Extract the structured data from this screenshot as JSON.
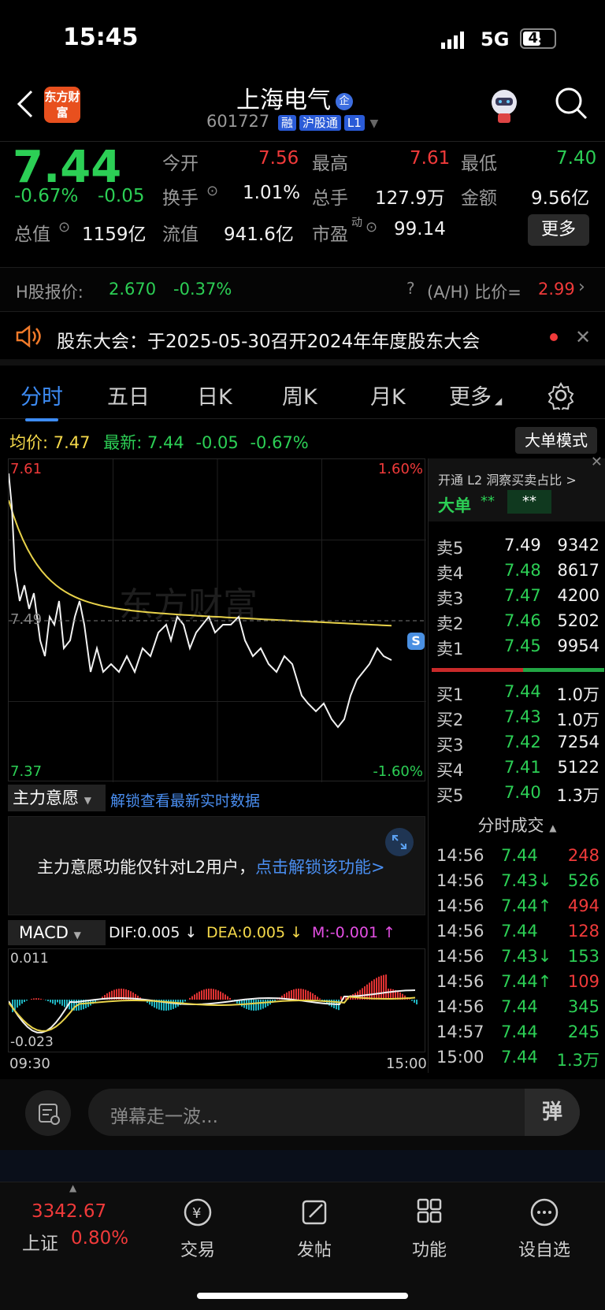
{
  "status_bar": {
    "time": "15:45",
    "network": "5G",
    "battery": "45"
  },
  "header": {
    "back_label": "<",
    "logo_text": "东方财富",
    "title": "上海电气",
    "title_badge": "企",
    "code": "601727",
    "tags": [
      "融",
      "沪股通",
      "L1"
    ],
    "colors": {
      "accent": "#3d8cf5",
      "up": "#f03a3a",
      "down": "#2ccf55"
    }
  },
  "quote": {
    "price": "7.44",
    "change_pct": "-0.67%",
    "change_amt": "-0.05",
    "open_label": "今开",
    "open": "7.56",
    "high_label": "最高",
    "high": "7.61",
    "low_label": "最低",
    "low": "7.40",
    "turnover_label": "换手",
    "turnover": "1.01%",
    "volume_label": "总手",
    "volume": "127.9万",
    "amount_label": "金额",
    "amount": "9.56亿",
    "mktcap_label": "总值",
    "mktcap": "1159亿",
    "float_label": "流值",
    "float": "941.6亿",
    "pe_label": "市盈",
    "pe_sup": "动",
    "pe": "99.14",
    "more_label": "更多"
  },
  "h_share": {
    "label": "H股报价:",
    "price": "2.670",
    "change": "-0.37%",
    "ratio_label": "(A/H) 比价=",
    "ratio": "2.99"
  },
  "notice": {
    "text": "股东大会：于2025-05-30召开2024年年度股东大会"
  },
  "tabs": [
    "分时",
    "五日",
    "日K",
    "周K",
    "月K",
    "更多"
  ],
  "intraday": {
    "avg_label": "均价:",
    "avg": "7.47",
    "latest_label": "最新:",
    "latest": "7.44",
    "latest_chg": "-0.05",
    "latest_pct": "-0.67%",
    "mode_button": "大单模式",
    "price_top": "7.61",
    "price_bottom": "7.37",
    "price_mid": "7.49",
    "pct_top": "1.60%",
    "pct_bottom": "-1.60%",
    "watermark": "东方财富",
    "marker": "S"
  },
  "main_force": {
    "dropdown": "主力意愿",
    "unlock_link": "解锁查看最新实时数据",
    "message": "主力意愿功能仅针对L2用户，",
    "message_link": "点击解锁该功能>"
  },
  "macd": {
    "dropdown": "MACD",
    "dif": "DIF:0.005 ↓",
    "dea": "DEA:0.005 ↓",
    "m": "M:-0.001 ↑",
    "y_top": "0.011",
    "y_bottom": "-0.023",
    "time_start": "09:30",
    "time_end": "15:00"
  },
  "order_book": {
    "l2_banner": "开通 L2 洞察买卖占比 >",
    "big_label": "大单",
    "big_val1": "**",
    "big_val2": "**",
    "asks": [
      {
        "label": "卖5",
        "price": "7.49",
        "vol": "9342"
      },
      {
        "label": "卖4",
        "price": "7.48",
        "vol": "8617"
      },
      {
        "label": "卖3",
        "price": "7.47",
        "vol": "4200"
      },
      {
        "label": "卖2",
        "price": "7.46",
        "vol": "5202"
      },
      {
        "label": "卖1",
        "price": "7.45",
        "vol": "9954"
      }
    ],
    "bids": [
      {
        "label": "买1",
        "price": "7.44",
        "vol": "1.0万"
      },
      {
        "label": "买2",
        "price": "7.43",
        "vol": "1.0万"
      },
      {
        "label": "买3",
        "price": "7.42",
        "vol": "7254"
      },
      {
        "label": "买4",
        "price": "7.41",
        "vol": "5122"
      },
      {
        "label": "买5",
        "price": "7.40",
        "vol": "1.3万"
      }
    ],
    "trades_title": "分时成交",
    "trades": [
      {
        "time": "14:56",
        "price": "7.44",
        "arrow": "",
        "vol": "248",
        "pc": "green",
        "vc": "red"
      },
      {
        "time": "14:56",
        "price": "7.43↓",
        "arrow": "",
        "vol": "526",
        "pc": "green",
        "vc": "green"
      },
      {
        "time": "14:56",
        "price": "7.44↑",
        "arrow": "",
        "vol": "494",
        "pc": "green",
        "vc": "red"
      },
      {
        "time": "14:56",
        "price": "7.44",
        "arrow": "",
        "vol": "128",
        "pc": "green",
        "vc": "red"
      },
      {
        "time": "14:56",
        "price": "7.43↓",
        "arrow": "",
        "vol": "153",
        "pc": "green",
        "vc": "green"
      },
      {
        "time": "14:56",
        "price": "7.44↑",
        "arrow": "",
        "vol": "109",
        "pc": "green",
        "vc": "red"
      },
      {
        "time": "14:56",
        "price": "7.44",
        "arrow": "",
        "vol": "345",
        "pc": "green",
        "vc": "green"
      },
      {
        "time": "14:57",
        "price": "7.44",
        "arrow": "",
        "vol": "245",
        "pc": "green",
        "vc": "green"
      },
      {
        "time": "15:00",
        "price": "7.44",
        "arrow": "",
        "vol": "1.3万",
        "pc": "green",
        "vc": "green"
      }
    ]
  },
  "danmaku": {
    "placeholder": "弹幕走一波...",
    "send_label": "弹"
  },
  "bottom_nav": {
    "index_value": "3342.67",
    "index_name": "上证",
    "index_change": "0.80%",
    "items": [
      "交易",
      "发帖",
      "功能",
      "设自选"
    ]
  }
}
